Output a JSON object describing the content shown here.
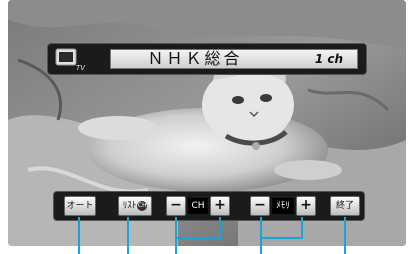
{
  "banner": {
    "tv_icon_label": "TV",
    "channel_name": "ＮＨＫ総合",
    "channel_number": "1 ch"
  },
  "controls": {
    "auto_label": "オート",
    "list_label": "ﾘｽﾄ",
    "list_badge": "CH",
    "ch_minus": "−",
    "ch_label": "CH",
    "ch_plus": "+",
    "memory_minus": "−",
    "memory_label": "ﾒﾓﾘ",
    "memory_plus": "+",
    "end_label": "終了"
  },
  "colors": {
    "bar_bg": "#1b1b1b",
    "button_light": "#ffffff",
    "callout_line": "#1aa3d9"
  },
  "icons": [
    "tv-icon"
  ]
}
